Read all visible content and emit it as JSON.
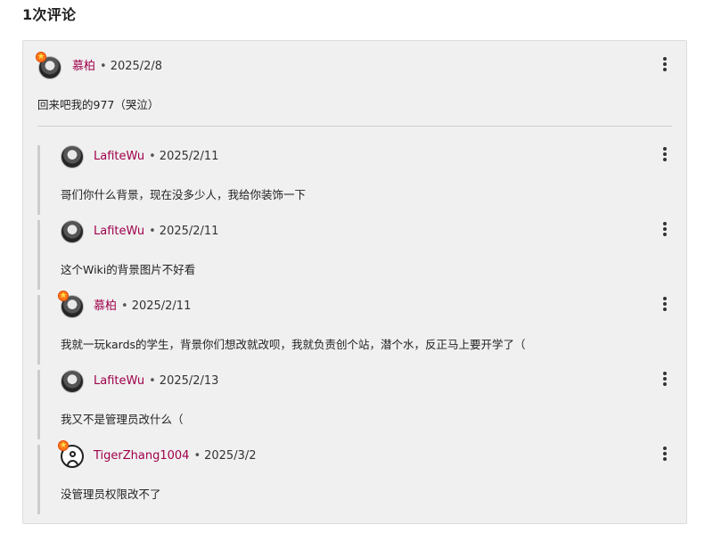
{
  "section": {
    "title": "1次评论"
  },
  "colors": {
    "author": "#a0004b",
    "thread_bg": "#f0f0f0",
    "reply_bar": "#cccccc",
    "badge": "#ff7a1a"
  },
  "root_comment": {
    "author": "慕柏",
    "separator": "•",
    "date": "2025/2/8",
    "text": "回来吧我的977（哭泣）",
    "avatar_icon": "user-avatar-icon",
    "has_badge": true
  },
  "replies": [
    {
      "author": "LafiteWu",
      "separator": "•",
      "date": "2025/2/11",
      "text": "哥们你什么背景，现在没多少人，我给你装饰一下",
      "avatar_icon": "user-avatar-icon",
      "has_badge": false
    },
    {
      "author": "LafiteWu",
      "separator": "•",
      "date": "2025/2/11",
      "text": "这个Wiki的背景图片不好看",
      "avatar_icon": "user-avatar-icon",
      "has_badge": false
    },
    {
      "author": "慕柏",
      "separator": "•",
      "date": "2025/2/11",
      "text": "我就一玩kards的学生，背景你们想改就改呗，我就负责创个站，潜个水，反正马上要开学了（",
      "avatar_icon": "user-avatar-icon",
      "has_badge": true
    },
    {
      "author": "LafiteWu",
      "separator": "•",
      "date": "2025/2/13",
      "text": "我又不是管理员改什么（",
      "avatar_icon": "user-avatar-icon",
      "has_badge": false
    },
    {
      "author": "TigerZhang1004",
      "separator": "•",
      "date": "2025/3/2",
      "text": "没管理员权限改不了",
      "avatar_icon": "default-user-icon",
      "has_badge": true
    }
  ]
}
